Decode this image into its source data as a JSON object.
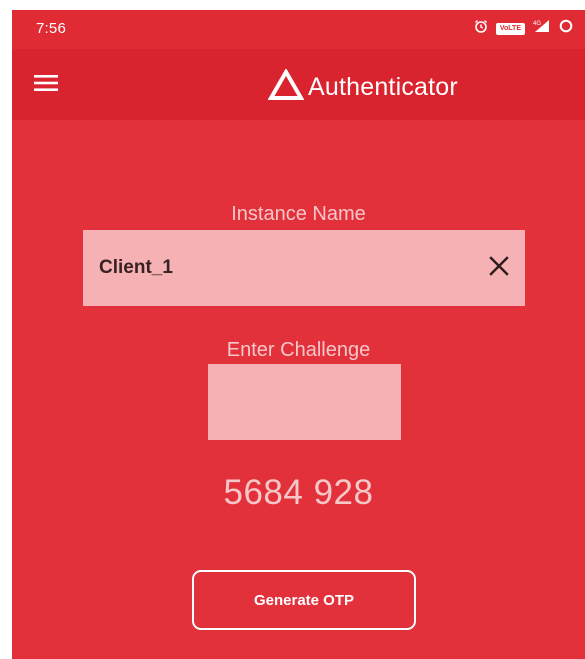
{
  "status_bar": {
    "time": "7:56",
    "volte_label": "VoLTE",
    "icons": [
      "alarm-icon",
      "volte-icon",
      "signal-icon",
      "loading-icon"
    ]
  },
  "toolbar": {
    "title": "Authenticator",
    "menu_icon": "hamburger-menu-icon",
    "logo_icon": "triangle-logo-icon"
  },
  "form": {
    "instance_label": "Instance Name",
    "instance_value": "Client_1",
    "clear_icon": "close-icon",
    "challenge_label": "Enter Challenge",
    "challenge_value": ""
  },
  "otp": {
    "value": "5684 928"
  },
  "actions": {
    "generate_label": "Generate OTP"
  },
  "colors": {
    "background": "#e2313b",
    "toolbar": "#d9232e",
    "status_bar": "#e02a34",
    "field": "#f5b1b4",
    "label_text": "#f6c7c9"
  }
}
